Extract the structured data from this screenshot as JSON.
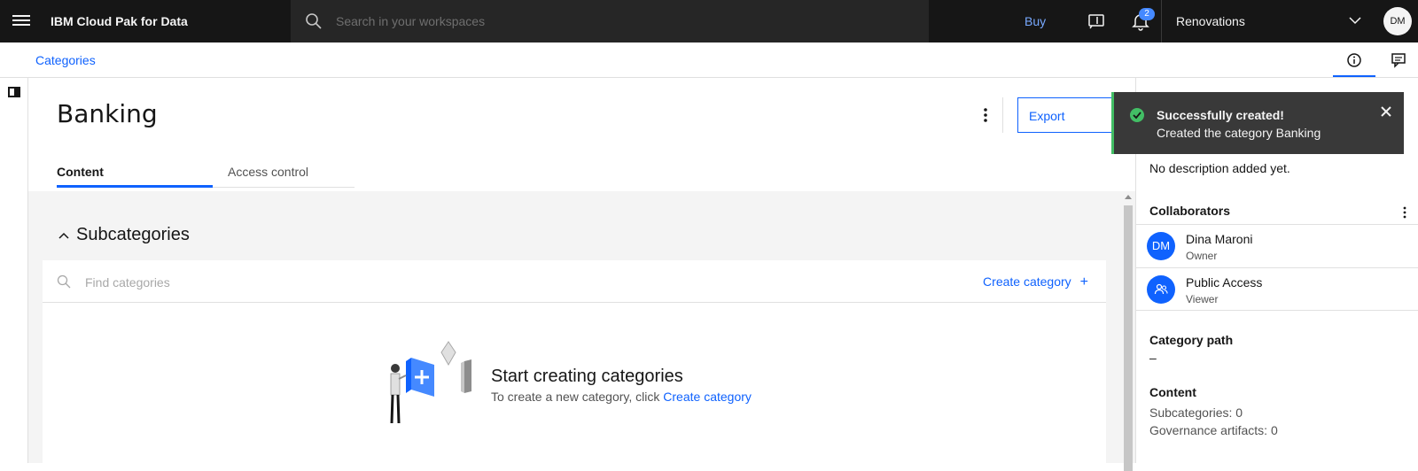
{
  "header": {
    "brand": "IBM Cloud Pak for Data",
    "search_placeholder": "Search in your workspaces",
    "buy_label": "Buy",
    "notification_count": "2",
    "workspace": "Renovations",
    "user_initials": "DM"
  },
  "breadcrumb": {
    "label": "Categories"
  },
  "page": {
    "title": "Banking",
    "export_label": "Export",
    "tabs": [
      {
        "label": "Content"
      },
      {
        "label": "Access control"
      }
    ]
  },
  "subcategories": {
    "heading": "Subcategories",
    "find_placeholder": "Find categories",
    "create_label": "Create category",
    "empty_title": "Start creating categories",
    "empty_text": "To create a new category, click ",
    "empty_link": "Create category"
  },
  "details": {
    "description": "No description added yet.",
    "collaborators_heading": "Collaborators",
    "collaborators": [
      {
        "initials": "DM",
        "name": "Dina Maroni",
        "role": "Owner"
      },
      {
        "initials": "",
        "name": "Public Access",
        "role": "Viewer"
      }
    ],
    "path_heading": "Category path",
    "path_value": "–",
    "content_heading": "Content",
    "subcategories_line": "Subcategories:  0",
    "artifacts_line": "Governance artifacts:  0"
  },
  "toast": {
    "title": "Successfully created!",
    "subtitle": "Created the category Banking"
  },
  "colors": {
    "brand_blue": "#0f62fe",
    "success_green": "#42be65",
    "header_bg": "#161616"
  }
}
